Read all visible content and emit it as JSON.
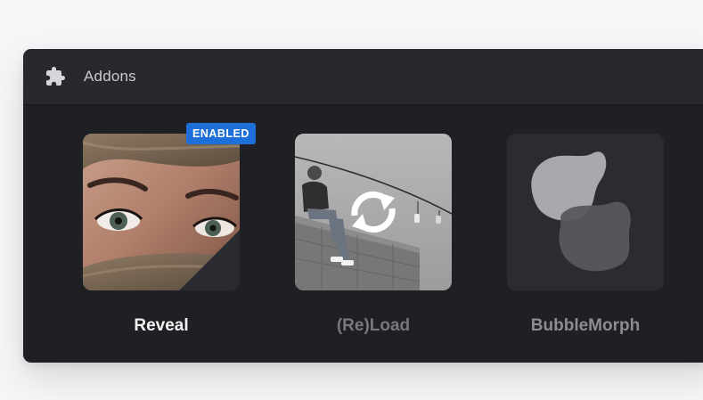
{
  "header": {
    "title": "Addons",
    "icon": "puzzle-icon"
  },
  "addons": [
    {
      "label": "Reveal",
      "badge": "ENABLED",
      "state": "enabled",
      "thumbnail": "face-with-scarf-image"
    },
    {
      "label": "(Re)Load",
      "state": "disabled",
      "thumbnail": "man-on-wall-photo",
      "overlay_icon": "reload-icon"
    },
    {
      "label": "BubbleMorph",
      "state": "disabled",
      "thumbnail": "bubble-morph-shapes"
    }
  ],
  "colors": {
    "panel_bg": "#1f2024",
    "header_bg": "#28292e",
    "badge": "#1e6fd9",
    "label_active": "#f2f2f2",
    "label_inactive": "#8b8c91"
  }
}
